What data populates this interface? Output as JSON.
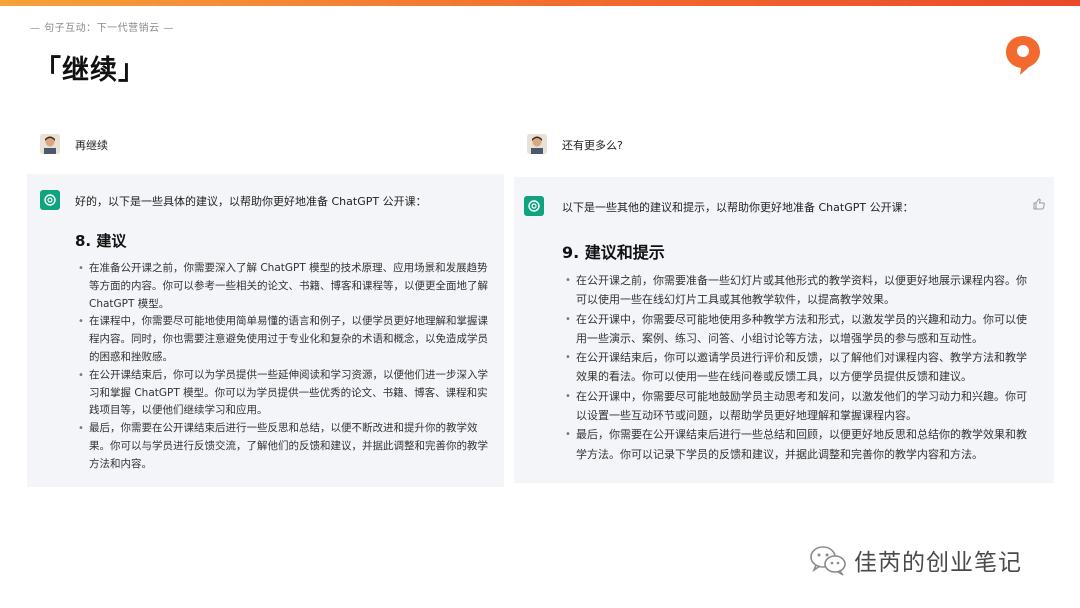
{
  "slide": {
    "tagline": "— 句子互动：下一代营销云 —",
    "title": "「继续」"
  },
  "left_chat": {
    "user_message": "再继续",
    "assistant_intro": "好的，以下是一些具体的建议，以帮助你更好地准备 ChatGPT 公开课：",
    "section_heading": "8. 建议",
    "bullets": [
      "在准备公开课之前，你需要深入了解 ChatGPT 模型的技术原理、应用场景和发展趋势等方面的内容。你可以参考一些相关的论文、书籍、博客和课程等，以便更全面地了解 ChatGPT 模型。",
      "在课程中，你需要尽可能地使用简单易懂的语言和例子，以便学员更好地理解和掌握课程内容。同时，你也需要注意避免使用过于专业化和复杂的术语和概念，以免造成学员的困惑和挫败感。",
      "在公开课结束后，你可以为学员提供一些延伸阅读和学习资源，以便他们进一步深入学习和掌握 ChatGPT 模型。你可以为学员提供一些优秀的论文、书籍、博客、课程和实践项目等，以便他们继续学习和应用。",
      "最后，你需要在公开课结束后进行一些反思和总结，以便不断改进和提升你的教学效果。你可以与学员进行反馈交流，了解他们的反馈和建议，并据此调整和完善你的教学方法和内容。"
    ]
  },
  "right_chat": {
    "user_message": "还有更多么?",
    "assistant_intro": "以下是一些其他的建议和提示，以帮助你更好地准备 ChatGPT 公开课：",
    "section_heading": "9. 建议和提示",
    "bullets": [
      "在公开课之前，你需要准备一些幻灯片或其他形式的教学资料，以便更好地展示课程内容。你可以使用一些在线幻灯片工具或其他教学软件，以提高教学效果。",
      "在公开课中，你需要尽可能地使用多种教学方法和形式，以激发学员的兴趣和动力。你可以使用一些演示、案例、练习、问答、小组讨论等方法，以增强学员的参与感和互动性。",
      "在公开课结束后，你可以邀请学员进行评价和反馈，以了解他们对课程内容、教学方法和教学效果的看法。你可以使用一些在线问卷或反馈工具，以方便学员提供反馈和建议。",
      "在公开课中，你需要尽可能地鼓励学员主动思考和发问，以激发他们的学习动力和兴趣。你可以设置一些互动环节或问题，以帮助学员更好地理解和掌握课程内容。",
      "最后，你需要在公开课结束后进行一些总结和回顾，以便更好地反思和总结你的教学效果和教学方法。你可以记录下学员的反馈和建议，并据此调整和完善你的教学内容和方法。"
    ]
  },
  "watermark": {
    "text": "佳芮的创业笔记",
    "icon": "wechat-icon"
  },
  "icons": {
    "brand_logo": "speech-bubble-logo",
    "assistant_avatar": "openai-icon",
    "feedback": "thumbs-up-icon"
  },
  "colors": {
    "accent_orange": "#f26a2e",
    "assistant_green": "#10a37f",
    "panel_bg": "#f4f5f8"
  }
}
